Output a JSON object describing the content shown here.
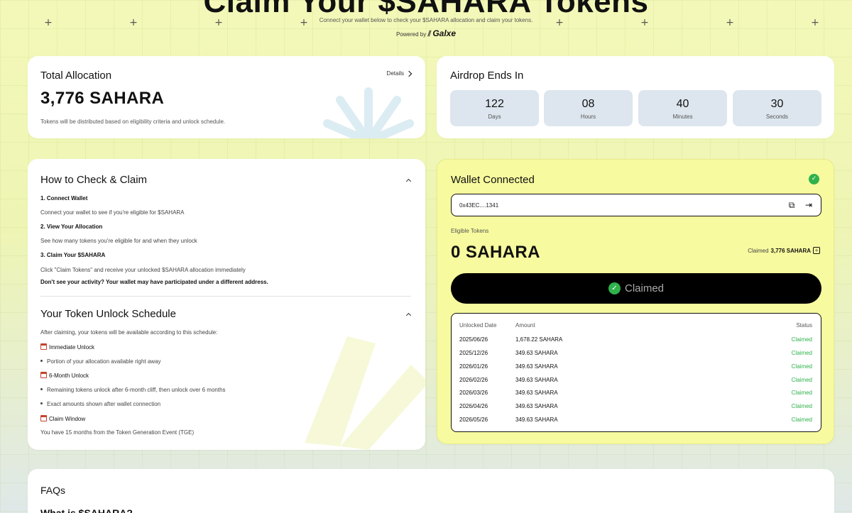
{
  "hero": {
    "title": "Claim Your $SAHARA Tokens",
    "subtitle": "Connect your wallet below to check your $SAHARA allocation and claim your tokens.",
    "powered_by_label": "Powered by",
    "powered_by_brand": "Galxe"
  },
  "allocation": {
    "title": "Total Allocation",
    "details_label": "Details",
    "amount": "3,776 SAHARA",
    "note": "Tokens will be distributed based on eligibility criteria and unlock schedule."
  },
  "airdrop": {
    "title": "Airdrop Ends In",
    "countdown": [
      {
        "value": "122",
        "label": "Days"
      },
      {
        "value": "08",
        "label": "Hours"
      },
      {
        "value": "40",
        "label": "Minutes"
      },
      {
        "value": "30",
        "label": "Seconds"
      }
    ]
  },
  "howto": {
    "title": "How to Check & Claim",
    "steps": [
      {
        "title": "1. Connect Wallet",
        "text": "Connect your wallet to see if you're eligible for $SAHARA"
      },
      {
        "title": "2. View Your Allocation",
        "text": "See how many tokens you're eligible for and when they unlock"
      },
      {
        "title": "3. Claim Your $SAHARA",
        "text": "Click \"Claim Tokens\" and receive your unlocked $SAHARA allocation immediately"
      }
    ],
    "warning": "Don't see your activity? Your wallet may have participated under a different address."
  },
  "unlock": {
    "title": "Your Token Unlock Schedule",
    "intro": "After claiming, your tokens will be available according to this schedule:",
    "immediate_title": "Immediate Unlock",
    "immediate_bullet": "Portion of your allocation available right away",
    "six_month_title": "6-Month Unlock",
    "six_month_bullets": [
      "Remaining tokens unlock after 6-month cliff, then unlock over 6 months",
      "Exact amounts shown after wallet connection"
    ],
    "window_title": "Claim Window",
    "window_text": "You have 15 months from the Token Generation Event (TGE)"
  },
  "wallet": {
    "title": "Wallet Connected",
    "address": "0x43EC....1341",
    "eligible_label": "Eligible Tokens",
    "eligible_amount": "0 SAHARA",
    "claimed_label": "Claimed",
    "claimed_amount": "3,776 SAHARA",
    "button_label": "Claimed",
    "table_headers": {
      "date": "Unlocked Date",
      "amount": "Amount",
      "status": "Status"
    },
    "rows": [
      {
        "date": "2025/06/26",
        "amount": "1,678.22 SAHARA",
        "status": "Claimed"
      },
      {
        "date": "2025/12/26",
        "amount": "349.63 SAHARA",
        "status": "Claimed"
      },
      {
        "date": "2026/01/26",
        "amount": "349.63 SAHARA",
        "status": "Claimed"
      },
      {
        "date": "2026/02/26",
        "amount": "349.63 SAHARA",
        "status": "Claimed"
      },
      {
        "date": "2026/03/26",
        "amount": "349.63 SAHARA",
        "status": "Claimed"
      },
      {
        "date": "2026/04/26",
        "amount": "349.63 SAHARA",
        "status": "Claimed"
      },
      {
        "date": "2026/05/26",
        "amount": "349.63 SAHARA",
        "status": "Claimed"
      }
    ]
  },
  "faq": {
    "title": "FAQs",
    "first_question": "What is $SAHARA?"
  },
  "colors": {
    "accent_green": "#2fb24c",
    "claim_card_bg": "#f7fa9e",
    "countdown_bg": "#dde6ee"
  },
  "icons": {
    "copy": "copy-icon",
    "disconnect": "logout-icon",
    "calendar": "calendar-icon",
    "check": "check-icon"
  }
}
